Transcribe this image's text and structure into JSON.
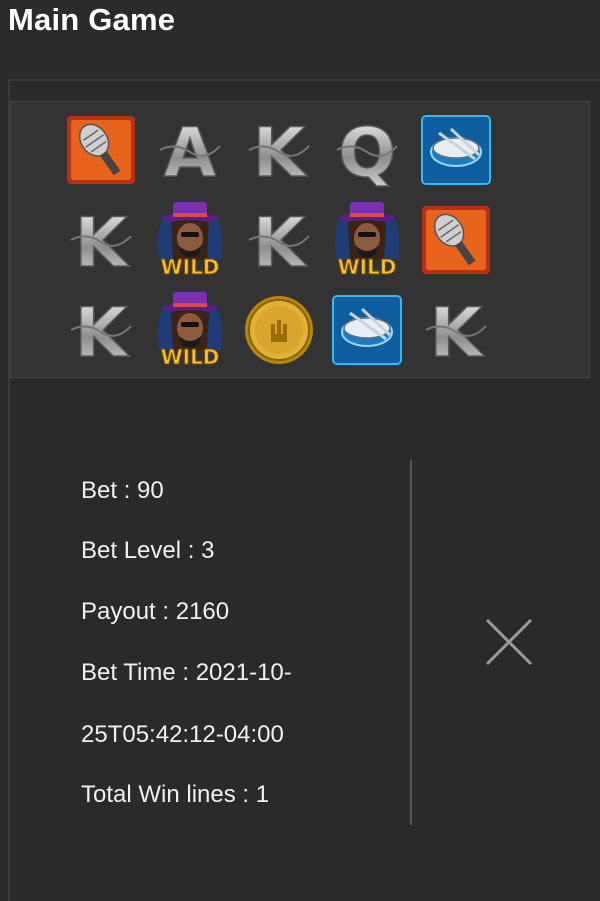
{
  "header": {
    "title": "Main Game"
  },
  "reels": {
    "rows": [
      [
        {
          "symbol": "microphone-icon"
        },
        {
          "symbol": "letter-a-icon",
          "glyph": "A"
        },
        {
          "symbol": "letter-k-icon",
          "glyph": "K"
        },
        {
          "symbol": "letter-q-icon",
          "glyph": "Q"
        },
        {
          "symbol": "drum-icon"
        }
      ],
      [
        {
          "symbol": "letter-k-icon",
          "glyph": "K"
        },
        {
          "symbol": "wild-rocker-icon",
          "label": "WILD"
        },
        {
          "symbol": "letter-k-icon",
          "glyph": "K"
        },
        {
          "symbol": "wild-rocker-icon",
          "label": "WILD"
        },
        {
          "symbol": "microphone-icon"
        }
      ],
      [
        {
          "symbol": "letter-k-icon",
          "glyph": "K"
        },
        {
          "symbol": "wild-rocker-icon",
          "label": "WILD"
        },
        {
          "symbol": "gold-coin-icon"
        },
        {
          "symbol": "drum-icon"
        },
        {
          "symbol": "letter-k-icon",
          "glyph": "K"
        }
      ]
    ]
  },
  "details": {
    "bet": "Bet : 90",
    "bet_level": "Bet Level : 3",
    "payout": "Payout : 2160",
    "bet_time_line1": "Bet Time : 2021-10-",
    "bet_time_line2": "25T05:42:12-04:00",
    "total_win_lines": "Total Win lines : 1"
  },
  "close_icon": "close-icon",
  "colors": {
    "background": "#2b2b2b",
    "reel_bg": "#333333",
    "text": "#f0f0f0",
    "divider": "#555555"
  }
}
